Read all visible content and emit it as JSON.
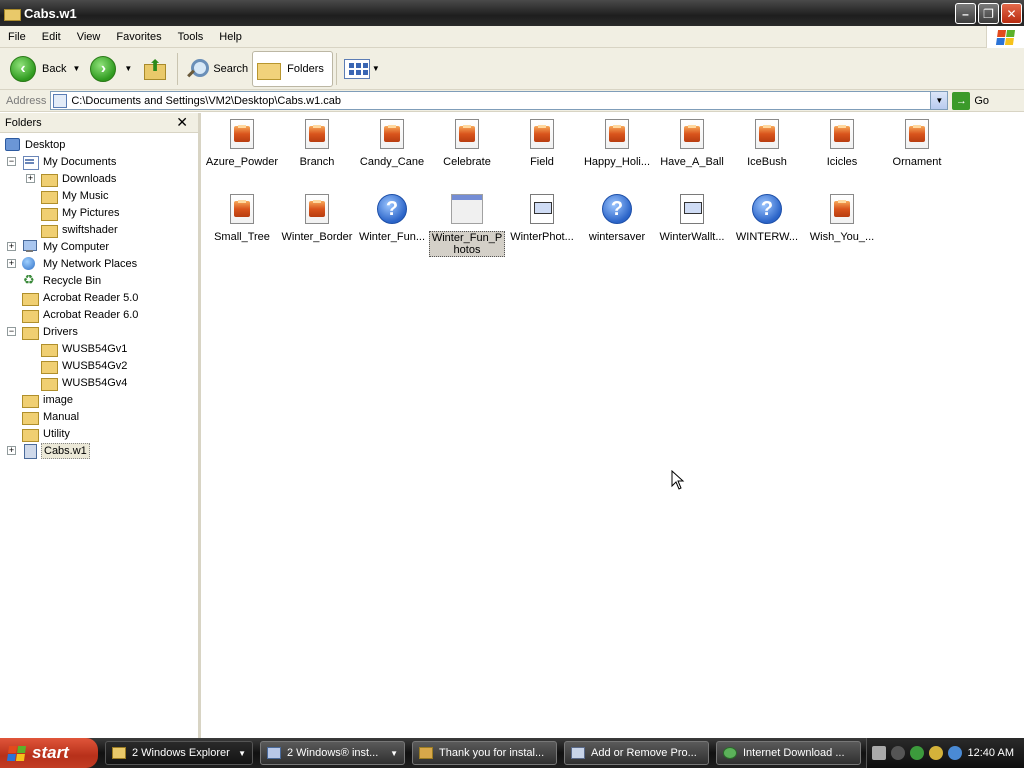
{
  "window": {
    "title": "Cabs.w1"
  },
  "menu": [
    "File",
    "Edit",
    "View",
    "Favorites",
    "Tools",
    "Help"
  ],
  "toolbar": {
    "back": "Back",
    "search": "Search",
    "folders": "Folders"
  },
  "address": {
    "label": "Address",
    "value": "C:\\Documents and Settings\\VM2\\Desktop\\Cabs.w1.cab",
    "go": "Go"
  },
  "folders_pane": {
    "title": "Folders",
    "tree": [
      "Desktop",
      "My Documents",
      "Downloads",
      "My Music",
      "My Pictures",
      "swiftshader",
      "My Computer",
      "My Network Places",
      "Recycle Bin",
      "Acrobat Reader 5.0",
      "Acrobat Reader 6.0",
      "Drivers",
      "WUSB54Gv1",
      "WUSB54Gv2",
      "WUSB54Gv4",
      "image",
      "Manual",
      "Utility",
      "Cabs.w1"
    ]
  },
  "files": [
    "Azure_Powder",
    "Branch",
    "Candy_Cane",
    "Celebrate",
    "Field",
    "Happy_Holi...",
    "Have_A_Ball",
    "IceBush",
    "Icicles",
    "Ornament",
    "Small_Tree",
    "Winter_Border",
    "Winter_Fun...",
    "Winter_Fun_Photos",
    "WinterPhot...",
    "wintersaver",
    "WinterWallt...",
    "WINTERW...",
    "Wish_You_..."
  ],
  "taskbar": {
    "start": "start",
    "tasks": [
      "2 Windows Explorer",
      "2 Windows® inst...",
      "Thank you for instal...",
      "Add or Remove Pro...",
      "Internet Download ..."
    ],
    "clock": "12:40 AM"
  }
}
